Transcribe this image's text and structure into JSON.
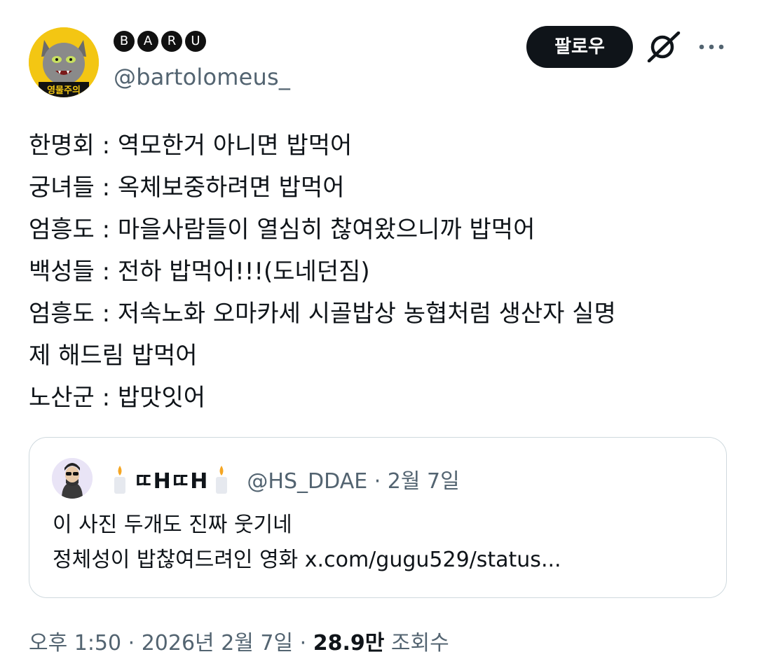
{
  "author": {
    "display_name_letters": [
      "B",
      "A",
      "R",
      "U"
    ],
    "handle": "@bartolomeus_",
    "avatar_caption": "영물주의"
  },
  "header": {
    "follow_label": "팔로우",
    "grok_icon": "grok-slash-icon",
    "more_icon": "more-dots-icon"
  },
  "tweet": {
    "lines": [
      "한명회 : 역모한거 아니면 밥먹어",
      "궁녀들 : 옥체보중하려면 밥먹어",
      "엄흥도 : 마을사람들이 열심히 찮여왔으니까 밥먹어",
      "백성들 : 전하 밥먹어!!!(도네던짐)",
      "엄흥도 : 저속노화 오마카세 시골밥상 농협처럼 생산자 실명",
      "제 해드림 밥먹어",
      "노산군 : 밥맛잇어"
    ]
  },
  "quote": {
    "name": "ㄸHㄸH",
    "handle_date": "@HS_DDAE · 2월 7일",
    "lines": [
      "이 사진 두개도 진짜 웃기네",
      "정체성이 밥찮여드려인 영화 x.com/gugu529/status..."
    ]
  },
  "footer": {
    "time_date": "오후 1:50 · 2026년 2월 7일 · ",
    "views_count": "28.9만",
    "views_label": " 조회수"
  },
  "colors": {
    "text": "#0f1419",
    "secondary": "#536471",
    "border": "#cfd9de",
    "avatar_bg": "#f3c613"
  }
}
